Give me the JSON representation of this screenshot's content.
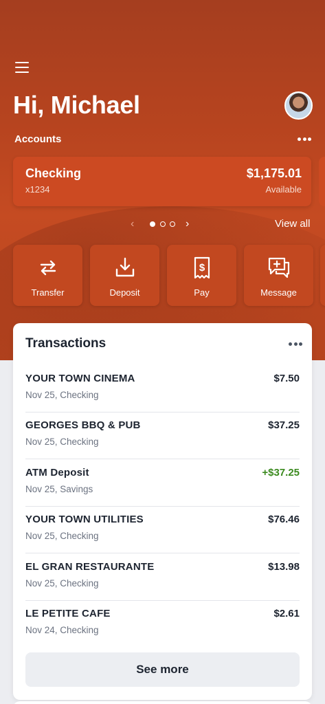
{
  "header": {
    "greeting": "Hi, Michael",
    "accounts_label": "Accounts"
  },
  "account": {
    "name": "Checking",
    "number": "x1234",
    "balance": "$1,175.01",
    "balance_label": "Available",
    "pager": {
      "current": 1,
      "total": 3
    },
    "view_all": "View all"
  },
  "actions": [
    {
      "label": "Transfer",
      "icon": "transfer-icon"
    },
    {
      "label": "Deposit",
      "icon": "deposit-icon"
    },
    {
      "label": "Pay",
      "icon": "bill-icon"
    },
    {
      "label": "Message",
      "icon": "message-add-icon"
    }
  ],
  "transactions": {
    "title": "Transactions",
    "items": [
      {
        "name": "YOUR TOWN CINEMA",
        "sub": "Nov 25, Checking",
        "amount": "$7.50",
        "credit": false
      },
      {
        "name": "GEORGES BBQ & PUB",
        "sub": "Nov 25, Checking",
        "amount": "$37.25",
        "credit": false
      },
      {
        "name": "ATM Deposit",
        "sub": "Nov 25, Savings",
        "amount": "+$37.25",
        "credit": true
      },
      {
        "name": "YOUR TOWN UTILITIES",
        "sub": "Nov 25, Checking",
        "amount": "$76.46",
        "credit": false
      },
      {
        "name": "EL GRAN RESTAURANTE",
        "sub": "Nov 25, Checking",
        "amount": "$13.98",
        "credit": false
      },
      {
        "name": "LE PETITE CAFE",
        "sub": "Nov 24, Checking",
        "amount": "$2.61",
        "credit": false
      }
    ],
    "see_more": "See more"
  },
  "colors": {
    "brand": "#c24820",
    "credit": "#3b8a1f"
  }
}
